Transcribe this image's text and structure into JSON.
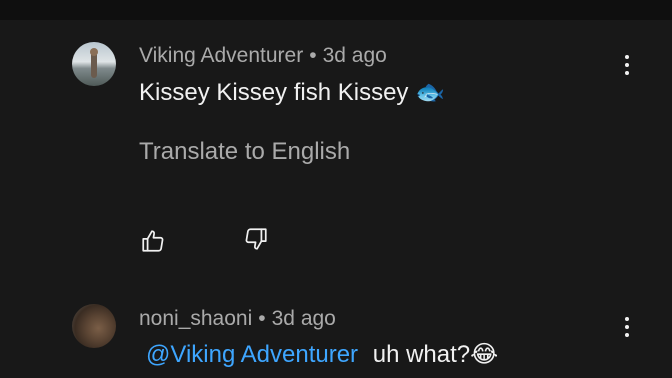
{
  "comments": [
    {
      "author": "Viking Adventurer",
      "separator": "•",
      "time": "3d ago",
      "text": "Kissey Kissey fish Kissey",
      "emoji": "🐟",
      "translate_label": "Translate to English",
      "avatar": "person-standing-by-water-avatar",
      "like_icon": "thumbs-up-icon",
      "dislike_icon": "thumbs-down-icon",
      "menu_icon": "more-vertical-icon"
    },
    {
      "author": "noni_shaoni",
      "separator": "•",
      "time": "3d ago",
      "mention": "@Viking Adventurer",
      "text": "uh what?",
      "emoji": "😂",
      "avatar": "brown-photo-avatar",
      "menu_icon": "more-vertical-icon"
    }
  ],
  "colors": {
    "background": "#181818",
    "top_bar": "#0f0f0f",
    "primary_text": "#f1f1f1",
    "secondary_text": "#aaaaaa",
    "mention": "#3ea6ff"
  }
}
